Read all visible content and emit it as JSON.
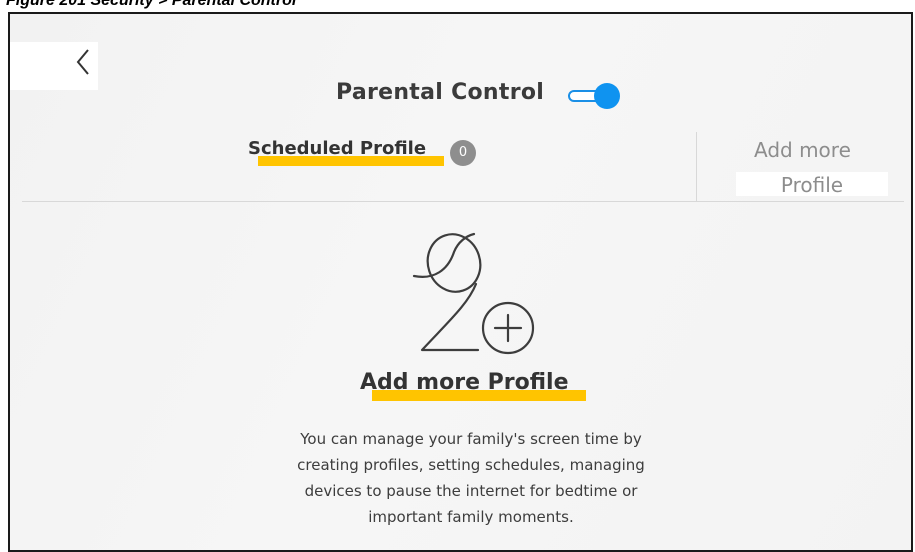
{
  "figure_caption": "Figure 201 Security > Parental Control",
  "header": {
    "title": "Parental Control",
    "toggle_on": true,
    "accent_color": "#0f93f0"
  },
  "tabs": {
    "scheduled_label": "Scheduled Profile",
    "scheduled_count": "0",
    "add_more_line1": "Add more",
    "add_more_line2": "Profile"
  },
  "main": {
    "heading": "Add more Profile",
    "description_lines": [
      "You can manage your family's screen time by",
      "creating profiles, setting schedules, managing",
      "devices to pause the internet for bedtime or",
      "important family moments."
    ]
  },
  "icons": {
    "back": "chevron-left-icon",
    "add_profile": "add-profile-icon"
  },
  "colors": {
    "highlight": "#ffc400",
    "badge": "#8e8e8e",
    "muted_text": "#8d8d8d"
  }
}
